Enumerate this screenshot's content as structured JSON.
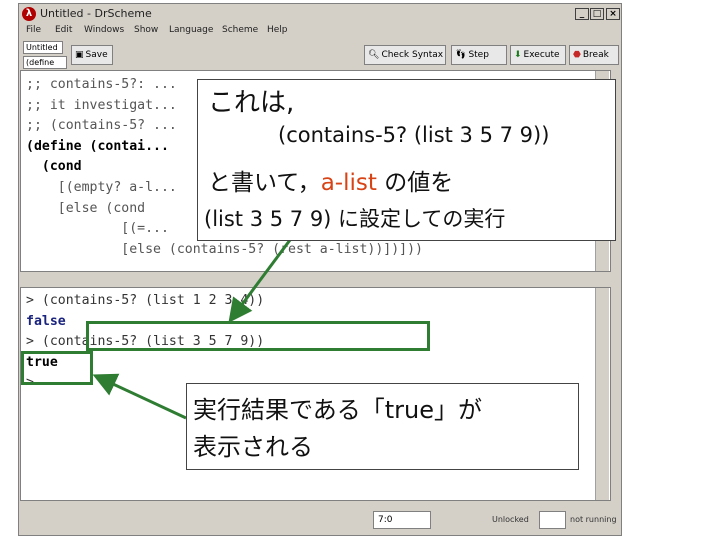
{
  "window": {
    "title": "Untitled - DrScheme",
    "buttons": {
      "minimize": "_",
      "maximize": "□",
      "close": "×"
    }
  },
  "menu": [
    "File",
    "Edit",
    "Windows",
    "Show",
    "Language",
    "Scheme",
    "Help"
  ],
  "toolbar": {
    "file_name": "Untitled",
    "define_menu": "(define ...)",
    "save_label": "Save",
    "check_syntax_label": "Check Syntax",
    "step_label": "Step",
    "execute_label": "Execute",
    "break_label": "Break"
  },
  "definitions": [
    ";; contains-5?: ...",
    ";; it investigat...",
    ";; (contains-5? ...",
    "(define (contai...",
    "  (cond",
    "    [(empty? a-l...",
    "    [else (cond",
    "            [(=...",
    "            [else (contains-5? (rest a-list))])]))"
  ],
  "interactions": [
    "> (contains-5? (list 1 2 3 4))",
    "false",
    "> (contains-5? (list 3 5 7 9))",
    "true",
    ">"
  ],
  "status": {
    "position": "7:0",
    "unlocked": "Unlocked",
    "state": "not running"
  },
  "callout_top": {
    "line1": "これは,",
    "line2": "(contains-5? (list 3 5 7 9))",
    "line3_pre": "と書いて，",
    "line3_var": "a-list",
    "line3_post": "の値を",
    "line4": "(list 3 5 7 9) に設定しての実行"
  },
  "callout_bottom": {
    "line1": "実行結果である「true」が",
    "line2": "表示される"
  },
  "colors": {
    "highlight_border": "#2e7d32",
    "variable_text": "#d84315"
  }
}
